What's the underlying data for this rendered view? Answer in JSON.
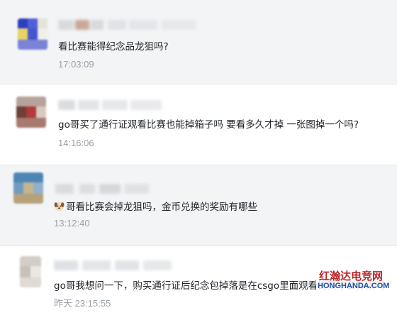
{
  "comments": [
    {
      "message": "看比赛能得纪念品龙狙吗?",
      "time": "17:03:09"
    },
    {
      "message": "go哥买了通行证观看比赛也能掉箱子吗 要看多久才掉 一张图掉一个吗?",
      "time": "14:16:06"
    },
    {
      "message": "哥看比赛会掉龙狙吗，金币兑换的奖励有哪些",
      "time": "13:12:40",
      "emoji": "dog-face-icon"
    },
    {
      "message": "go哥我想问一下，购买通行证后纪念包掉落是在csgo里面观看比赛才会掉落吗",
      "time": "昨天 23:15:55"
    }
  ],
  "watermark": {
    "title": "红瀚达电竞网",
    "url": "HONGHANDA.COM"
  }
}
